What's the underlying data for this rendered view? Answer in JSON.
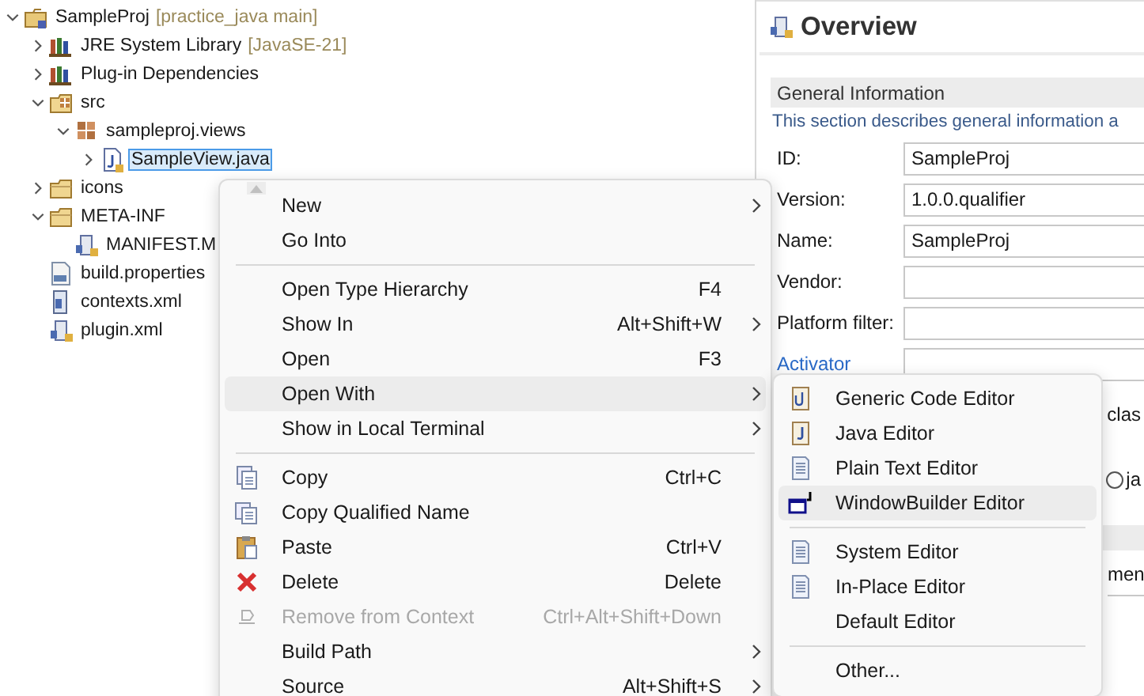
{
  "tree": [
    {
      "label": "SampleProj",
      "decoration": "[practice_java main]",
      "kind": "project",
      "expanded": true,
      "selected": false,
      "children": [
        {
          "label": "JRE System Library",
          "decoration": "[JavaSE-21]",
          "kind": "library",
          "expanded": false,
          "selected": false
        },
        {
          "label": "Plug-in Dependencies",
          "kind": "library",
          "expanded": false,
          "selected": false
        },
        {
          "label": "src",
          "kind": "source-folder",
          "expanded": true,
          "selected": false,
          "children": [
            {
              "label": "sampleproj.views",
              "kind": "package",
              "expanded": true,
              "selected": false,
              "children": [
                {
                  "label": "SampleView.java",
                  "kind": "java-file",
                  "expanded": false,
                  "selected": true
                }
              ]
            }
          ]
        },
        {
          "label": "icons",
          "kind": "folder",
          "expanded": false,
          "selected": false
        },
        {
          "label": "META-INF",
          "kind": "folder",
          "expanded": true,
          "selected": false,
          "children": [
            {
              "label": "MANIFEST.M",
              "kind": "manifest",
              "selected": false
            }
          ]
        },
        {
          "label": "build.properties",
          "kind": "properties",
          "selected": false
        },
        {
          "label": "contexts.xml",
          "kind": "xml",
          "selected": false
        },
        {
          "label": "plugin.xml",
          "kind": "manifest",
          "selected": false
        }
      ]
    }
  ],
  "editor": {
    "title": "Overview",
    "section": {
      "title": "General Information",
      "description": "This section describes general information a"
    },
    "fields": [
      {
        "label": "ID:",
        "value": "SampleProj",
        "kind": "text"
      },
      {
        "label": "Version:",
        "value": "1.0.0.qualifier",
        "kind": "text"
      },
      {
        "label": "Name:",
        "value": "SampleProj",
        "kind": "text"
      },
      {
        "label": "Vendor:",
        "kind": "text"
      },
      {
        "label": "Platform filter:",
        "kind": "text"
      },
      {
        "label": "Activator",
        "kind": "link"
      }
    ],
    "hint_fragment": "clas",
    "radio": {
      "label": "ja",
      "selected": false
    },
    "field_fragment": "men"
  },
  "context_menu": {
    "items": [
      {
        "kind": "plain",
        "label": "New",
        "submenu": true,
        "selected": false,
        "disabled": false
      },
      {
        "kind": "plain",
        "label": "Go Into",
        "submenu": false,
        "selected": false,
        "disabled": false
      },
      {
        "kind": "separator"
      },
      {
        "kind": "plain",
        "label": "Open Type Hierarchy",
        "shortcut": "F4",
        "submenu": false,
        "selected": false,
        "disabled": false
      },
      {
        "kind": "plain",
        "label": "Show In",
        "shortcut": "Alt+Shift+W",
        "submenu": true,
        "selected": false,
        "disabled": false
      },
      {
        "kind": "plain",
        "label": "Open",
        "shortcut": "F3",
        "submenu": false,
        "selected": false,
        "disabled": false
      },
      {
        "kind": "plain",
        "label": "Open With",
        "submenu": true,
        "selected": true,
        "disabled": false
      },
      {
        "kind": "plain",
        "label": "Show in Local Terminal",
        "submenu": true,
        "selected": false,
        "disabled": false
      },
      {
        "kind": "separator"
      },
      {
        "kind": "copy",
        "label": "Copy",
        "shortcut": "Ctrl+C",
        "submenu": false,
        "selected": false,
        "disabled": false
      },
      {
        "kind": "copy-name",
        "label": "Copy Qualified Name",
        "submenu": false,
        "selected": false,
        "disabled": false
      },
      {
        "kind": "paste",
        "label": "Paste",
        "shortcut": "Ctrl+V",
        "submenu": false,
        "selected": false,
        "disabled": false
      },
      {
        "kind": "delete",
        "label": "Delete",
        "shortcut": "Delete",
        "submenu": false,
        "selected": false,
        "disabled": false
      },
      {
        "kind": "remove",
        "label": "Remove from Context",
        "shortcut": "Ctrl+Alt+Shift+Down",
        "submenu": false,
        "selected": false,
        "disabled": true
      },
      {
        "kind": "plain",
        "label": "Build Path",
        "submenu": true,
        "selected": false,
        "disabled": false
      },
      {
        "kind": "plain",
        "label": "Source",
        "shortcut": "Alt+Shift+S",
        "submenu": true,
        "selected": false,
        "disabled": false
      }
    ]
  },
  "open_with_menu": {
    "items": [
      {
        "kind": "generic-code",
        "label": "Generic Code Editor",
        "selected": false
      },
      {
        "kind": "java",
        "label": "Java Editor",
        "selected": false
      },
      {
        "kind": "text",
        "label": "Plain Text Editor",
        "selected": false
      },
      {
        "kind": "windowbuilder",
        "label": "WindowBuilder Editor",
        "selected": true
      },
      {
        "kind": "separator"
      },
      {
        "kind": "text",
        "label": "System Editor",
        "selected": false
      },
      {
        "kind": "text",
        "label": "In-Place Editor",
        "selected": false
      },
      {
        "kind": "plain",
        "label": "Default Editor",
        "selected": false
      },
      {
        "kind": "separator"
      },
      {
        "kind": "plain",
        "label": "Other...",
        "selected": false
      }
    ]
  }
}
